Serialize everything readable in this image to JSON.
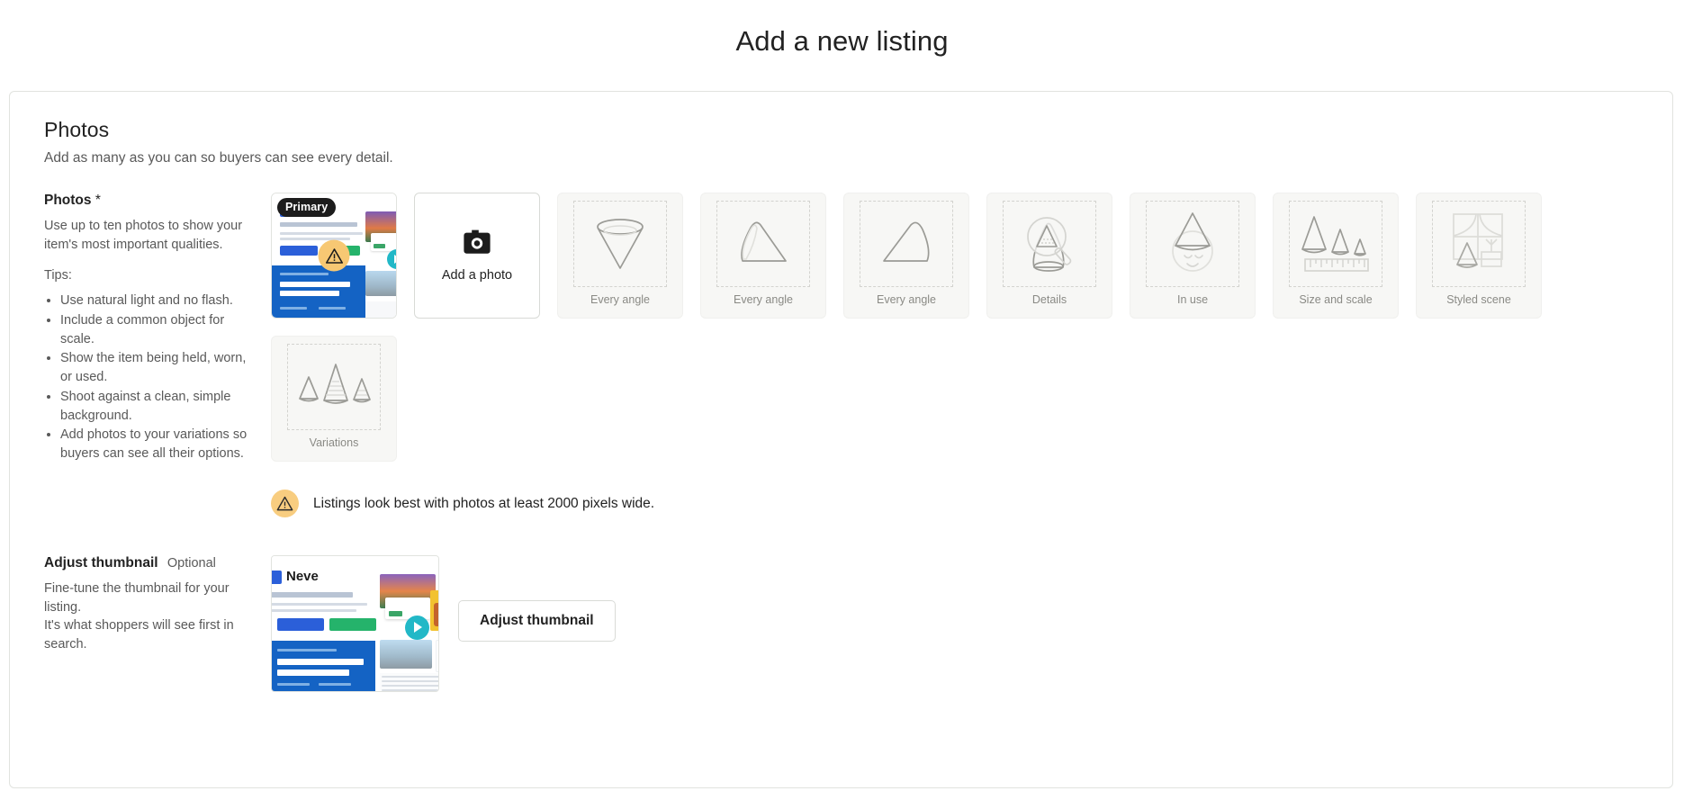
{
  "page": {
    "title": "Add a new listing"
  },
  "photos_section": {
    "heading": "Photos",
    "subheading": "Add as many as you can so buyers can see every detail.",
    "field_label": "Photos",
    "required_marker": "*",
    "help_text": "Use up to ten photos to show your item's most important qualities.",
    "tips_label": "Tips:",
    "tips": [
      "Use natural light and no flash.",
      "Include a common object for scale.",
      "Show the item being held, worn, or used.",
      "Shoot against a clean, simple background.",
      "Add photos to your variations so buyers can see all their options."
    ],
    "primary_badge": "Primary",
    "add_photo_label": "Add a photo",
    "placeholders": [
      {
        "label": "Every angle",
        "icon": "cone-inverted-icon"
      },
      {
        "label": "Every angle",
        "icon": "cone-side-left-icon"
      },
      {
        "label": "Every angle",
        "icon": "cone-side-right-icon"
      },
      {
        "label": "Details",
        "icon": "cone-magnifier-icon"
      },
      {
        "label": "In use",
        "icon": "cone-face-icon"
      },
      {
        "label": "Size and scale",
        "icon": "cones-ruler-icon"
      },
      {
        "label": "Styled scene",
        "icon": "cone-window-plant-icon"
      },
      {
        "label": "Variations",
        "icon": "cones-variations-icon"
      }
    ],
    "notice": {
      "icon": "warning-triangle-icon",
      "text": "Listings look best with photos at least 2000 pixels wide."
    },
    "thumbnail_preview_brand": "Neve"
  },
  "adjust_thumbnail": {
    "label": "Adjust thumbnail",
    "optional_tag": "Optional",
    "help_line_1": "Fine-tune the thumbnail for your listing.",
    "help_line_2": "It's what shoppers will see first in search.",
    "button_label": "Adjust thumbnail"
  },
  "colors": {
    "accent_warning": "#f7c873",
    "badge_bg": "#1c1c1c",
    "text_primary": "#222222",
    "text_muted": "#595959",
    "placeholder_bg": "#f7f7f5",
    "border": "#e1e3df"
  }
}
